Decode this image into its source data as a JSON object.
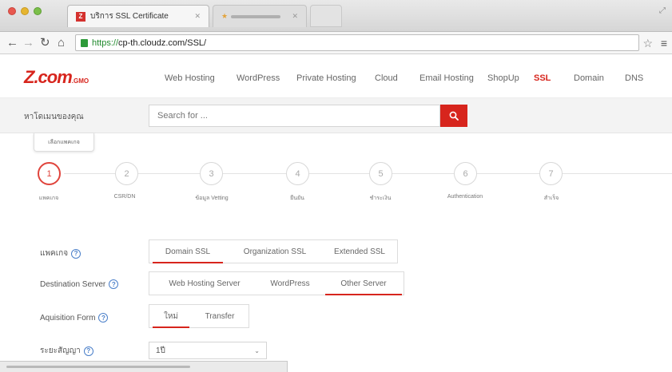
{
  "browser": {
    "active_tab_title": "บริการ SSL Certificate",
    "url_https": "https://",
    "url_rest": "cp-th.cloudz.com/SSL/"
  },
  "site": {
    "logo_text": "Z.com",
    "logo_suffix": ".GMO",
    "nav": [
      "Web Hosting",
      "WordPress",
      "Private Hosting",
      "Cloud",
      "Email Hosting",
      "ShopUp",
      "SSL",
      "Domain",
      "DNS"
    ],
    "active_nav": "SSL"
  },
  "search": {
    "label": "หาโดเมนของคุณ",
    "placeholder": "Search for ..."
  },
  "tooltip": "เลือกแพคเกจ",
  "steps": [
    {
      "num": "1",
      "label": "แพคเกจ",
      "active": true
    },
    {
      "num": "2",
      "label": "CSR/DN",
      "active": false
    },
    {
      "num": "3",
      "label": "ข้อมูล Vetting",
      "active": false
    },
    {
      "num": "4",
      "label": "ยืนยัน",
      "active": false
    },
    {
      "num": "5",
      "label": "ชำระเงิน",
      "active": false
    },
    {
      "num": "6",
      "label": "Authentication",
      "active": false
    },
    {
      "num": "7",
      "label": "สำเร็จ",
      "active": false
    }
  ],
  "form": {
    "plan": {
      "label": "แพคเกจ",
      "options": [
        "Domain SSL",
        "Organization SSL",
        "Extended SSL"
      ],
      "selected": "Domain SSL"
    },
    "destination": {
      "label": "Destination Server",
      "options": [
        "Web Hosting Server",
        "WordPress",
        "Other Server"
      ],
      "selected": "Other Server"
    },
    "acquisition": {
      "label": "Aquisition Form",
      "options": [
        "ใหม่",
        "Transfer"
      ],
      "selected": "ใหม่"
    },
    "term": {
      "label": "ระยะสัญญา",
      "value": "1ปี"
    }
  },
  "colors": {
    "brand": "#d7251d",
    "help": "#4a7fc9"
  }
}
